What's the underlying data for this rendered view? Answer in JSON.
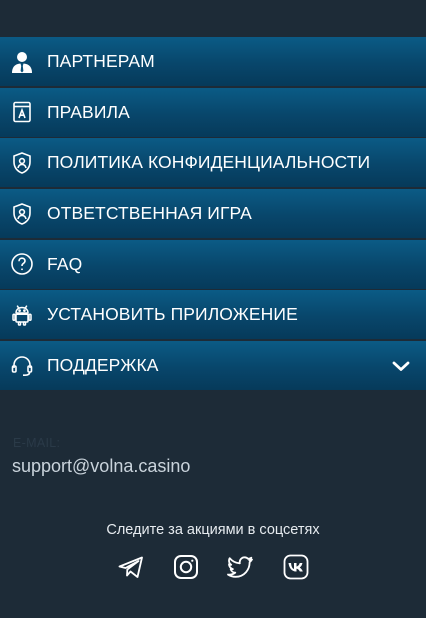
{
  "menu": {
    "items": [
      {
        "label": "ПАРТНЕРАМ",
        "icon": "partner-person-icon"
      },
      {
        "label": "ПРАВИЛА",
        "icon": "rules-book-icon"
      },
      {
        "label": "ПОЛИТИКА КОНФИДЕНЦИАЛЬНОСТИ",
        "icon": "shield-user-icon"
      },
      {
        "label": "ОТВЕТСТВЕННАЯ ИГРА",
        "icon": "shield-user-icon"
      },
      {
        "label": "FAQ",
        "icon": "question-circle-icon"
      },
      {
        "label": "УСТАНОВИТЬ ПРИЛОЖЕНИЕ",
        "icon": "android-icon"
      },
      {
        "label": "ПОДДЕРЖКА",
        "icon": "headset-icon",
        "expandable": true
      }
    ]
  },
  "contact": {
    "email_label": "E-MAIL:",
    "email_value": "support@volna.casino"
  },
  "social": {
    "title": "Следите за акциями в соцсетях",
    "icons": [
      "telegram-icon",
      "instagram-icon",
      "twitter-icon",
      "vk-icon"
    ]
  },
  "colors": {
    "background": "#1d2b37",
    "menu_item_top": "#0b5b86",
    "menu_item_bottom": "#063a5a",
    "text": "#ffffff"
  }
}
